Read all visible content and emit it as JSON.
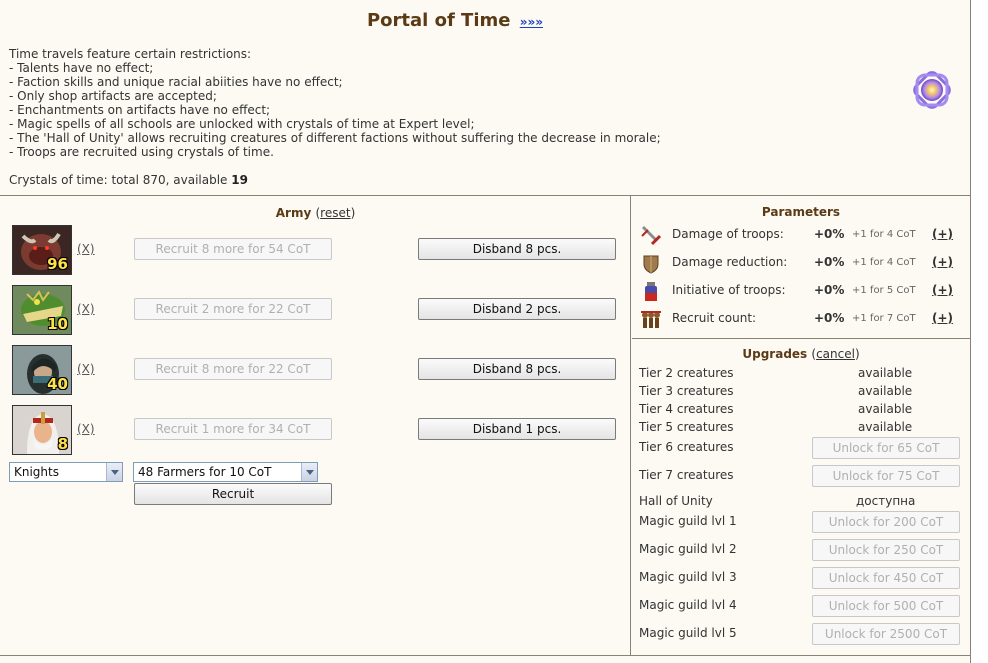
{
  "header": {
    "title": "Portal of Time",
    "more_link": "»»»",
    "rules": [
      "Time travels feature certain restrictions:",
      "- Talents have no effect;",
      "- Faction skills and unique racial abiities have no effect;",
      "- Only shop artifacts are accepted;",
      "- Enchantments on artifacts have no effect;",
      "- Magic spells of all schools are unlocked with crystals of time at Expert level;",
      "- The 'Hall of Unity' allows recruiting creatures of different factions without suffering the decrease in morale;",
      "- Troops are recruited using crystals of time."
    ],
    "crystals_label": "Crystals of time: total 870, available",
    "crystals_available": "19"
  },
  "army": {
    "title": "Army",
    "reset_open": "(",
    "reset_label": "reset",
    "reset_close": ")",
    "units": [
      {
        "count": "96",
        "remove": "(X)",
        "recruit": "Recruit 8 more for 54 CoT",
        "disband": "Disband 8 pcs."
      },
      {
        "count": "10",
        "remove": "(X)",
        "recruit": "Recruit 2 more for 22 CoT",
        "disband": "Disband 2 pcs."
      },
      {
        "count": "40",
        "remove": "(X)",
        "recruit": "Recruit 8 more for 22 CoT",
        "disband": "Disband 8 pcs."
      },
      {
        "count": "8",
        "remove": "(X)",
        "recruit": "Recruit 1 more for 34 CoT",
        "disband": "Disband 1 pcs."
      }
    ],
    "faction_select": "Knights",
    "creature_select": "48 Farmers for 10 CoT",
    "recruit_button": "Recruit"
  },
  "parameters": {
    "title": "Parameters",
    "rows": [
      {
        "label": "Damage of troops:",
        "value": "+0%",
        "cost": "+1 for 4 CoT",
        "plus": "(+)",
        "icon": "sword-icon"
      },
      {
        "label": "Damage reduction:",
        "value": "+0%",
        "cost": "+1 for 4 CoT",
        "plus": "(+)",
        "icon": "shield-icon"
      },
      {
        "label": "Initiative of troops:",
        "value": "+0%",
        "cost": "+1 for 5 CoT",
        "plus": "(+)",
        "icon": "potion-icon"
      },
      {
        "label": "Recruit count:",
        "value": "+0%",
        "cost": "+1 for 7 CoT",
        "plus": "(+)",
        "icon": "troops-icon"
      }
    ]
  },
  "upgrades": {
    "title": "Upgrades",
    "cancel_open": "(",
    "cancel_label": "cancel",
    "cancel_close": ")",
    "rows": [
      {
        "label": "Tier 2 creatures",
        "status": "available"
      },
      {
        "label": "Tier 3 creatures",
        "status": "available"
      },
      {
        "label": "Tier 4 creatures",
        "status": "available"
      },
      {
        "label": "Tier 5 creatures",
        "status": "available"
      },
      {
        "label": "Tier 6 creatures",
        "button": "Unlock for 65 CoT"
      },
      {
        "label": "Tier 7 creatures",
        "button": "Unlock for 75 CoT"
      },
      {
        "label": "Hall of Unity",
        "status": "доступна"
      },
      {
        "label": "Magic guild lvl 1",
        "button": "Unlock for 200 CoT"
      },
      {
        "label": "Magic guild lvl 2",
        "button": "Unlock for 250 CoT"
      },
      {
        "label": "Magic guild lvl 3",
        "button": "Unlock for 450 CoT"
      },
      {
        "label": "Magic guild lvl 4",
        "button": "Unlock for 500 CoT"
      },
      {
        "label": "Magic guild lvl 5",
        "button": "Unlock for 2500 CoT"
      }
    ]
  }
}
